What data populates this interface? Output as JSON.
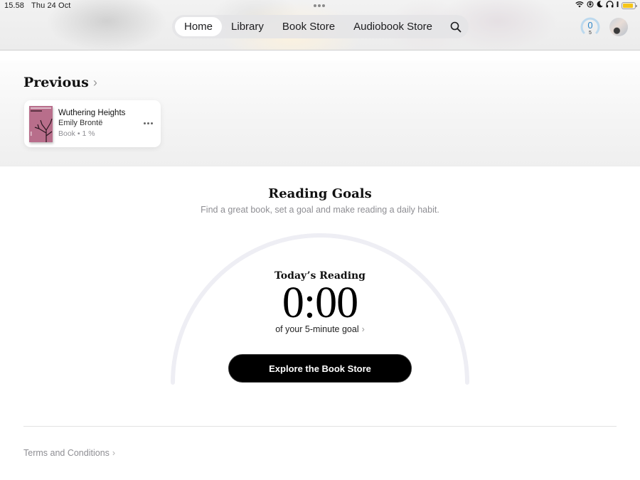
{
  "status_bar": {
    "time": "15.58",
    "date": "Thu 24 Oct",
    "icons": [
      "wifi-icon",
      "orientation-lock-icon",
      "moon-icon",
      "headphones-icon",
      "battery-icon"
    ],
    "battery_level": 0.85,
    "battery_color": "#f5c518"
  },
  "nav": {
    "tabs": [
      {
        "label": "Home",
        "active": true
      },
      {
        "label": "Library",
        "active": false
      },
      {
        "label": "Book Store",
        "active": false
      },
      {
        "label": "Audiobook Store",
        "active": false
      }
    ],
    "search_icon": "search-icon"
  },
  "header_right": {
    "goal_minutes": "0",
    "goal_target": "5",
    "goal_color": "#2f86c8",
    "avatar": "profile-avatar"
  },
  "previous": {
    "title": "Previous",
    "chevron": "›",
    "book": {
      "title": "Wuthering Heights",
      "author": "Emily Brontë",
      "meta": "Book • 1 %",
      "progress_percent": 1,
      "cover_color": "#b86e8b"
    }
  },
  "reading_goals": {
    "title": "Reading Goals",
    "subtitle": "Find a great book, set a goal and make reading a daily habit.",
    "todays_label": "Today’s Reading",
    "timer": "0:00",
    "goal_text": "of your 5-minute goal",
    "goal_progress": 0,
    "chevron": "›",
    "button_label": "Explore the Book Store"
  },
  "footer": {
    "terms_label": "Terms and Conditions",
    "chevron": "›"
  }
}
